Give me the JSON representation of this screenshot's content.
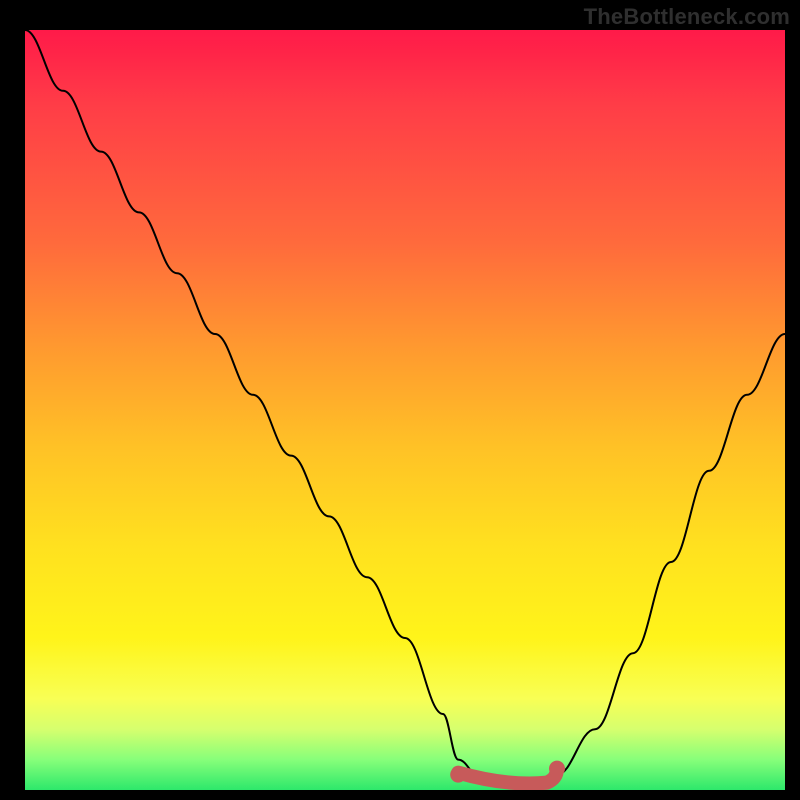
{
  "watermark": "TheBottleneck.com",
  "chart_data": {
    "type": "line",
    "title": "",
    "xlabel": "",
    "ylabel": "",
    "xlim": [
      0,
      100
    ],
    "ylim": [
      0,
      100
    ],
    "x": [
      0,
      5,
      10,
      15,
      20,
      25,
      30,
      35,
      40,
      45,
      50,
      55,
      57,
      60,
      63,
      66,
      68,
      70,
      75,
      80,
      85,
      90,
      95,
      100
    ],
    "values": [
      100,
      92,
      84,
      76,
      68,
      60,
      52,
      44,
      36,
      28,
      20,
      10,
      4,
      1.5,
      1,
      1,
      1.2,
      2,
      8,
      18,
      30,
      42,
      52,
      60
    ],
    "optimal_range_x": [
      57,
      70
    ],
    "optimal_range_y": 1.5,
    "gradient_stops": [
      {
        "pct": 0,
        "color": "#ff1a49"
      },
      {
        "pct": 10,
        "color": "#ff3d47"
      },
      {
        "pct": 28,
        "color": "#ff6a3c"
      },
      {
        "pct": 42,
        "color": "#ff9a2f"
      },
      {
        "pct": 55,
        "color": "#ffc226"
      },
      {
        "pct": 68,
        "color": "#ffe11f"
      },
      {
        "pct": 80,
        "color": "#fff41a"
      },
      {
        "pct": 88,
        "color": "#f8ff55"
      },
      {
        "pct": 92,
        "color": "#d6ff6e"
      },
      {
        "pct": 96,
        "color": "#87ff7a"
      },
      {
        "pct": 100,
        "color": "#2de86b"
      }
    ],
    "curve_color": "#000000",
    "marker_color": "#c75a5a"
  }
}
